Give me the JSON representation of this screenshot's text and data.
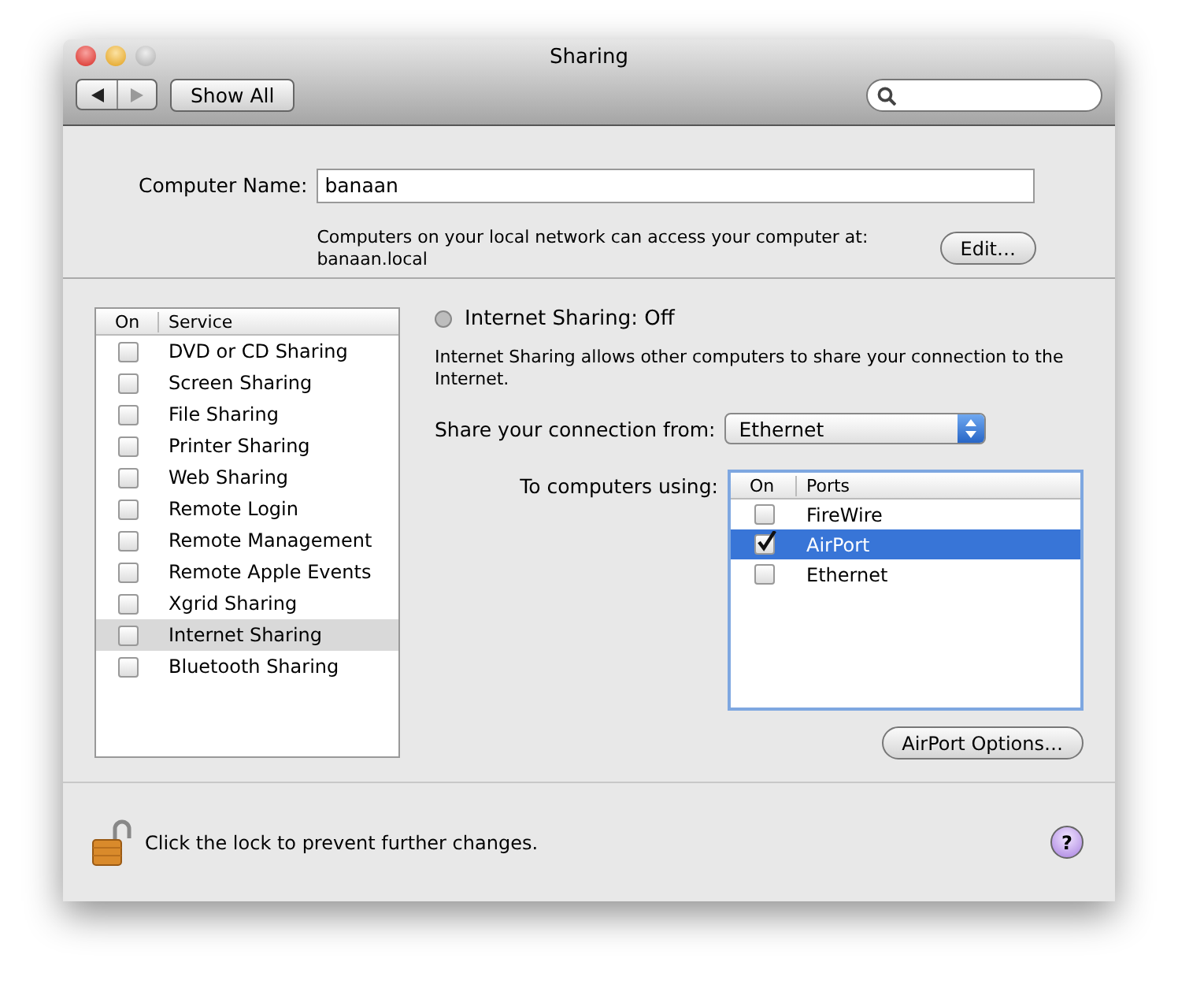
{
  "window": {
    "title": "Sharing"
  },
  "toolbar": {
    "show_all": "Show All"
  },
  "computer_name": {
    "label": "Computer Name:",
    "value": "banaan",
    "info": "Computers on your local network can access your computer at:",
    "address": "banaan.local",
    "edit_button": "Edit…"
  },
  "services": {
    "columns": [
      "On",
      "Service"
    ],
    "rows": [
      {
        "name": "DVD or CD Sharing",
        "checked": false,
        "selected": false
      },
      {
        "name": "Screen Sharing",
        "checked": false,
        "selected": false
      },
      {
        "name": "File Sharing",
        "checked": false,
        "selected": false
      },
      {
        "name": "Printer Sharing",
        "checked": false,
        "selected": false
      },
      {
        "name": "Web Sharing",
        "checked": false,
        "selected": false
      },
      {
        "name": "Remote Login",
        "checked": false,
        "selected": false
      },
      {
        "name": "Remote Management",
        "checked": false,
        "selected": false
      },
      {
        "name": "Remote Apple Events",
        "checked": false,
        "selected": false
      },
      {
        "name": "Xgrid Sharing",
        "checked": false,
        "selected": false
      },
      {
        "name": "Internet Sharing",
        "checked": false,
        "selected": true
      },
      {
        "name": "Bluetooth Sharing",
        "checked": false,
        "selected": false
      }
    ]
  },
  "detail": {
    "status": "Internet Sharing: Off",
    "on": false,
    "description": "Internet Sharing allows other computers to share your connection to the Internet.",
    "share_from_label": "Share your connection from:",
    "share_from_value": "Ethernet",
    "to_label": "To computers using:",
    "ports": {
      "columns": [
        "On",
        "Ports"
      ],
      "rows": [
        {
          "name": "FireWire",
          "checked": false,
          "selected": false
        },
        {
          "name": "AirPort",
          "checked": true,
          "selected": true
        },
        {
          "name": "Ethernet",
          "checked": false,
          "selected": false
        }
      ]
    },
    "options_button": "AirPort Options…"
  },
  "footer": {
    "lock_text": "Click the lock to prevent further changes.",
    "help": "?"
  }
}
